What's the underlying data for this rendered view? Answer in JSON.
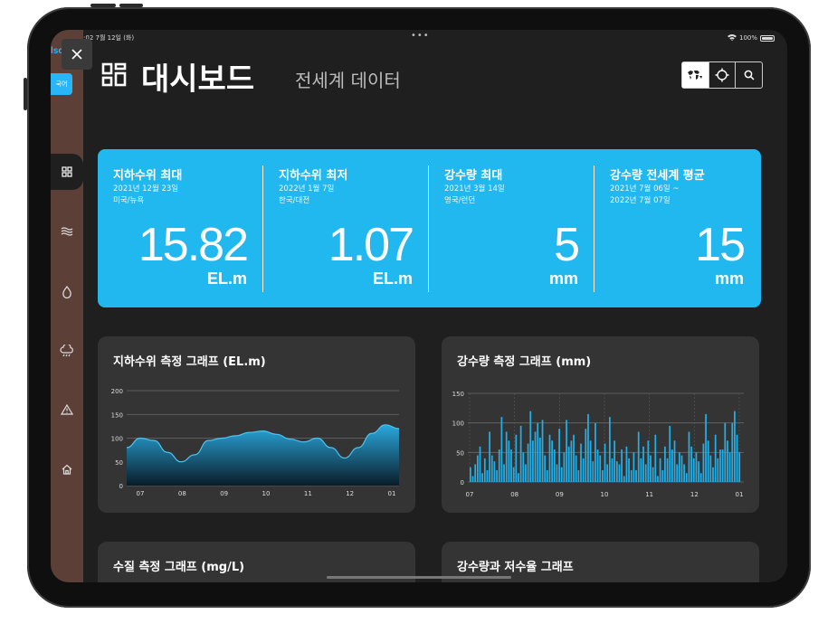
{
  "status_bar": {
    "time_date": "오전 11:02  7월 12일 (화)",
    "dots": "•••",
    "battery": "100%"
  },
  "sidebar": {
    "edge_label": "lsc",
    "language_button": "국어",
    "icons": [
      "dashboard-icon",
      "wave-icon",
      "droplet-icon",
      "cloud-rain-icon",
      "warning-icon",
      "home-icon"
    ]
  },
  "header": {
    "title": "대시보드",
    "subtitle": "전세계 데이터",
    "toolbar": [
      "world-map-icon",
      "crosshair-icon",
      "search-icon"
    ]
  },
  "stats": [
    {
      "name": "지하수위 최대",
      "date": "2021년 12월 23일\n미국/뉴욕",
      "value": "15.82",
      "unit": "EL.m"
    },
    {
      "name": "지하수위 최저",
      "date": "2022년 1월 7일\n한국/대전",
      "value": "1.07",
      "unit": "EL.m"
    },
    {
      "name": "강수량 최대",
      "date": "2021년 3월 14일\n영국/런던",
      "value": "5",
      "unit": "mm"
    },
    {
      "name": "강수량 전세계 평균",
      "date": "2021년 7월 06일 ~\n2022년 7월 07일",
      "value": "15",
      "unit": "mm"
    }
  ],
  "cards": {
    "groundwater_title": "지하수위 측정 그래프 (EL.m)",
    "rainfall_title": "강수량 측정 그래프 (mm)",
    "water_quality_title": "수질 측정 그래프 (mg/L)",
    "rain_reservoir_title": "강수량과 저수율 그래프"
  },
  "chart_data": [
    {
      "type": "area",
      "title": "지하수위 측정 그래프 (EL.m)",
      "x": [
        "07",
        "08",
        "09",
        "10",
        "11",
        "12",
        "01"
      ],
      "y_ticks": [
        0,
        50,
        100,
        150,
        200
      ],
      "ylim": [
        0,
        200
      ],
      "series": [
        {
          "values": [
            80,
            100,
            95,
            70,
            50,
            65,
            95,
            100,
            105,
            112,
            115,
            108,
            98,
            92,
            100,
            80,
            58,
            80,
            110,
            128,
            120
          ]
        }
      ],
      "grid": true
    },
    {
      "type": "bar",
      "title": "강수량 측정 그래프 (mm)",
      "x": [
        "07",
        "08",
        "09",
        "10",
        "11",
        "12",
        "01"
      ],
      "y_ticks": [
        0,
        50,
        100,
        150
      ],
      "ylim": [
        0,
        150
      ],
      "series": [
        {
          "values": [
            25,
            10,
            30,
            45,
            60,
            15,
            40,
            20,
            85,
            45,
            35,
            20,
            55,
            110,
            30,
            85,
            70,
            55,
            25,
            80,
            15,
            95,
            50,
            30,
            65,
            120,
            70,
            85,
            100,
            75,
            105,
            45,
            20,
            80,
            70,
            55,
            30,
            90,
            25,
            50,
            105,
            60,
            70,
            80,
            45,
            20,
            65,
            40,
            90,
            115,
            70,
            35,
            100,
            55,
            45,
            20,
            65,
            30,
            110,
            40,
            70,
            35,
            30,
            55,
            10,
            60,
            40,
            20,
            50,
            20,
            85,
            40,
            60,
            30,
            70,
            45,
            25,
            80,
            10,
            40,
            20,
            60,
            40,
            95,
            55,
            70,
            30,
            50,
            45,
            30,
            15,
            85,
            60,
            40,
            50,
            35,
            15,
            65,
            115,
            70,
            45,
            25,
            80,
            40,
            55,
            55,
            100,
            70,
            50,
            100,
            120,
            80,
            50
          ]
        }
      ],
      "grid": true
    }
  ]
}
